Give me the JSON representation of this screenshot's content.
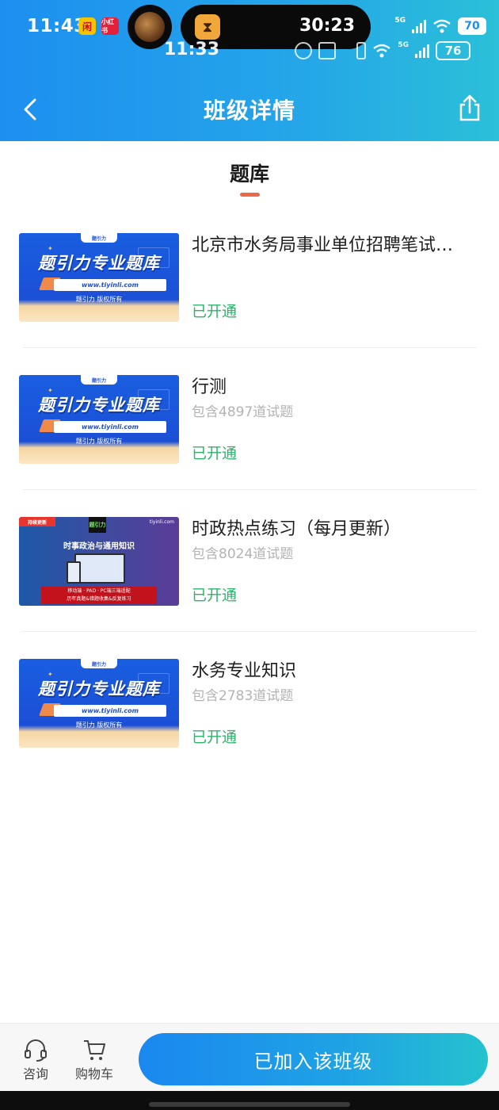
{
  "status_bar": {
    "time": "11:43",
    "app_badge_1": "闲",
    "app_badge_2": "小红书",
    "timer": "30:23",
    "signal_label": "5G",
    "battery": "70"
  },
  "inner_status_bar": {
    "time": "11:33",
    "signal_label": "5G",
    "battery": "76"
  },
  "nav": {
    "title": "班级详情"
  },
  "tab": {
    "label": "题库"
  },
  "thumbnail_text": {
    "brand_small": "题引力",
    "title": "题引力专业题库",
    "url": "www.tiyinli.com",
    "copyright": "题引力 版权所有",
    "update_badge": "持续更新",
    "brand_logo": "题引力",
    "site": "tiyinli.com",
    "subject": "时事政治与通用知识",
    "banner_line1": "移动端 · PAD · PC端三端适配",
    "banner_line2": "历年真题&错题收集&反复练习"
  },
  "items": [
    {
      "name": "北京市水务局事业单位招聘笔试题库",
      "count": "",
      "status": "已开通",
      "thumb": "blue"
    },
    {
      "name": "行测",
      "count": "包含4897道试题",
      "status": "已开通",
      "thumb": "blue"
    },
    {
      "name": "时政热点练习（每月更新）",
      "count": "包含8024道试题",
      "status": "已开通",
      "thumb": "purple"
    },
    {
      "name": "水务专业知识",
      "count": "包含2783道试题",
      "status": "已开通",
      "thumb": "blue"
    }
  ],
  "bottom_bar": {
    "consult_label": "咨询",
    "cart_label": "购物车",
    "join_label": "已加入该班级"
  },
  "colors": {
    "header_start": "#1d8ff0",
    "header_end": "#2bc0d8",
    "status_green": "#2fb36b",
    "tab_underline": "#ea6a45"
  }
}
